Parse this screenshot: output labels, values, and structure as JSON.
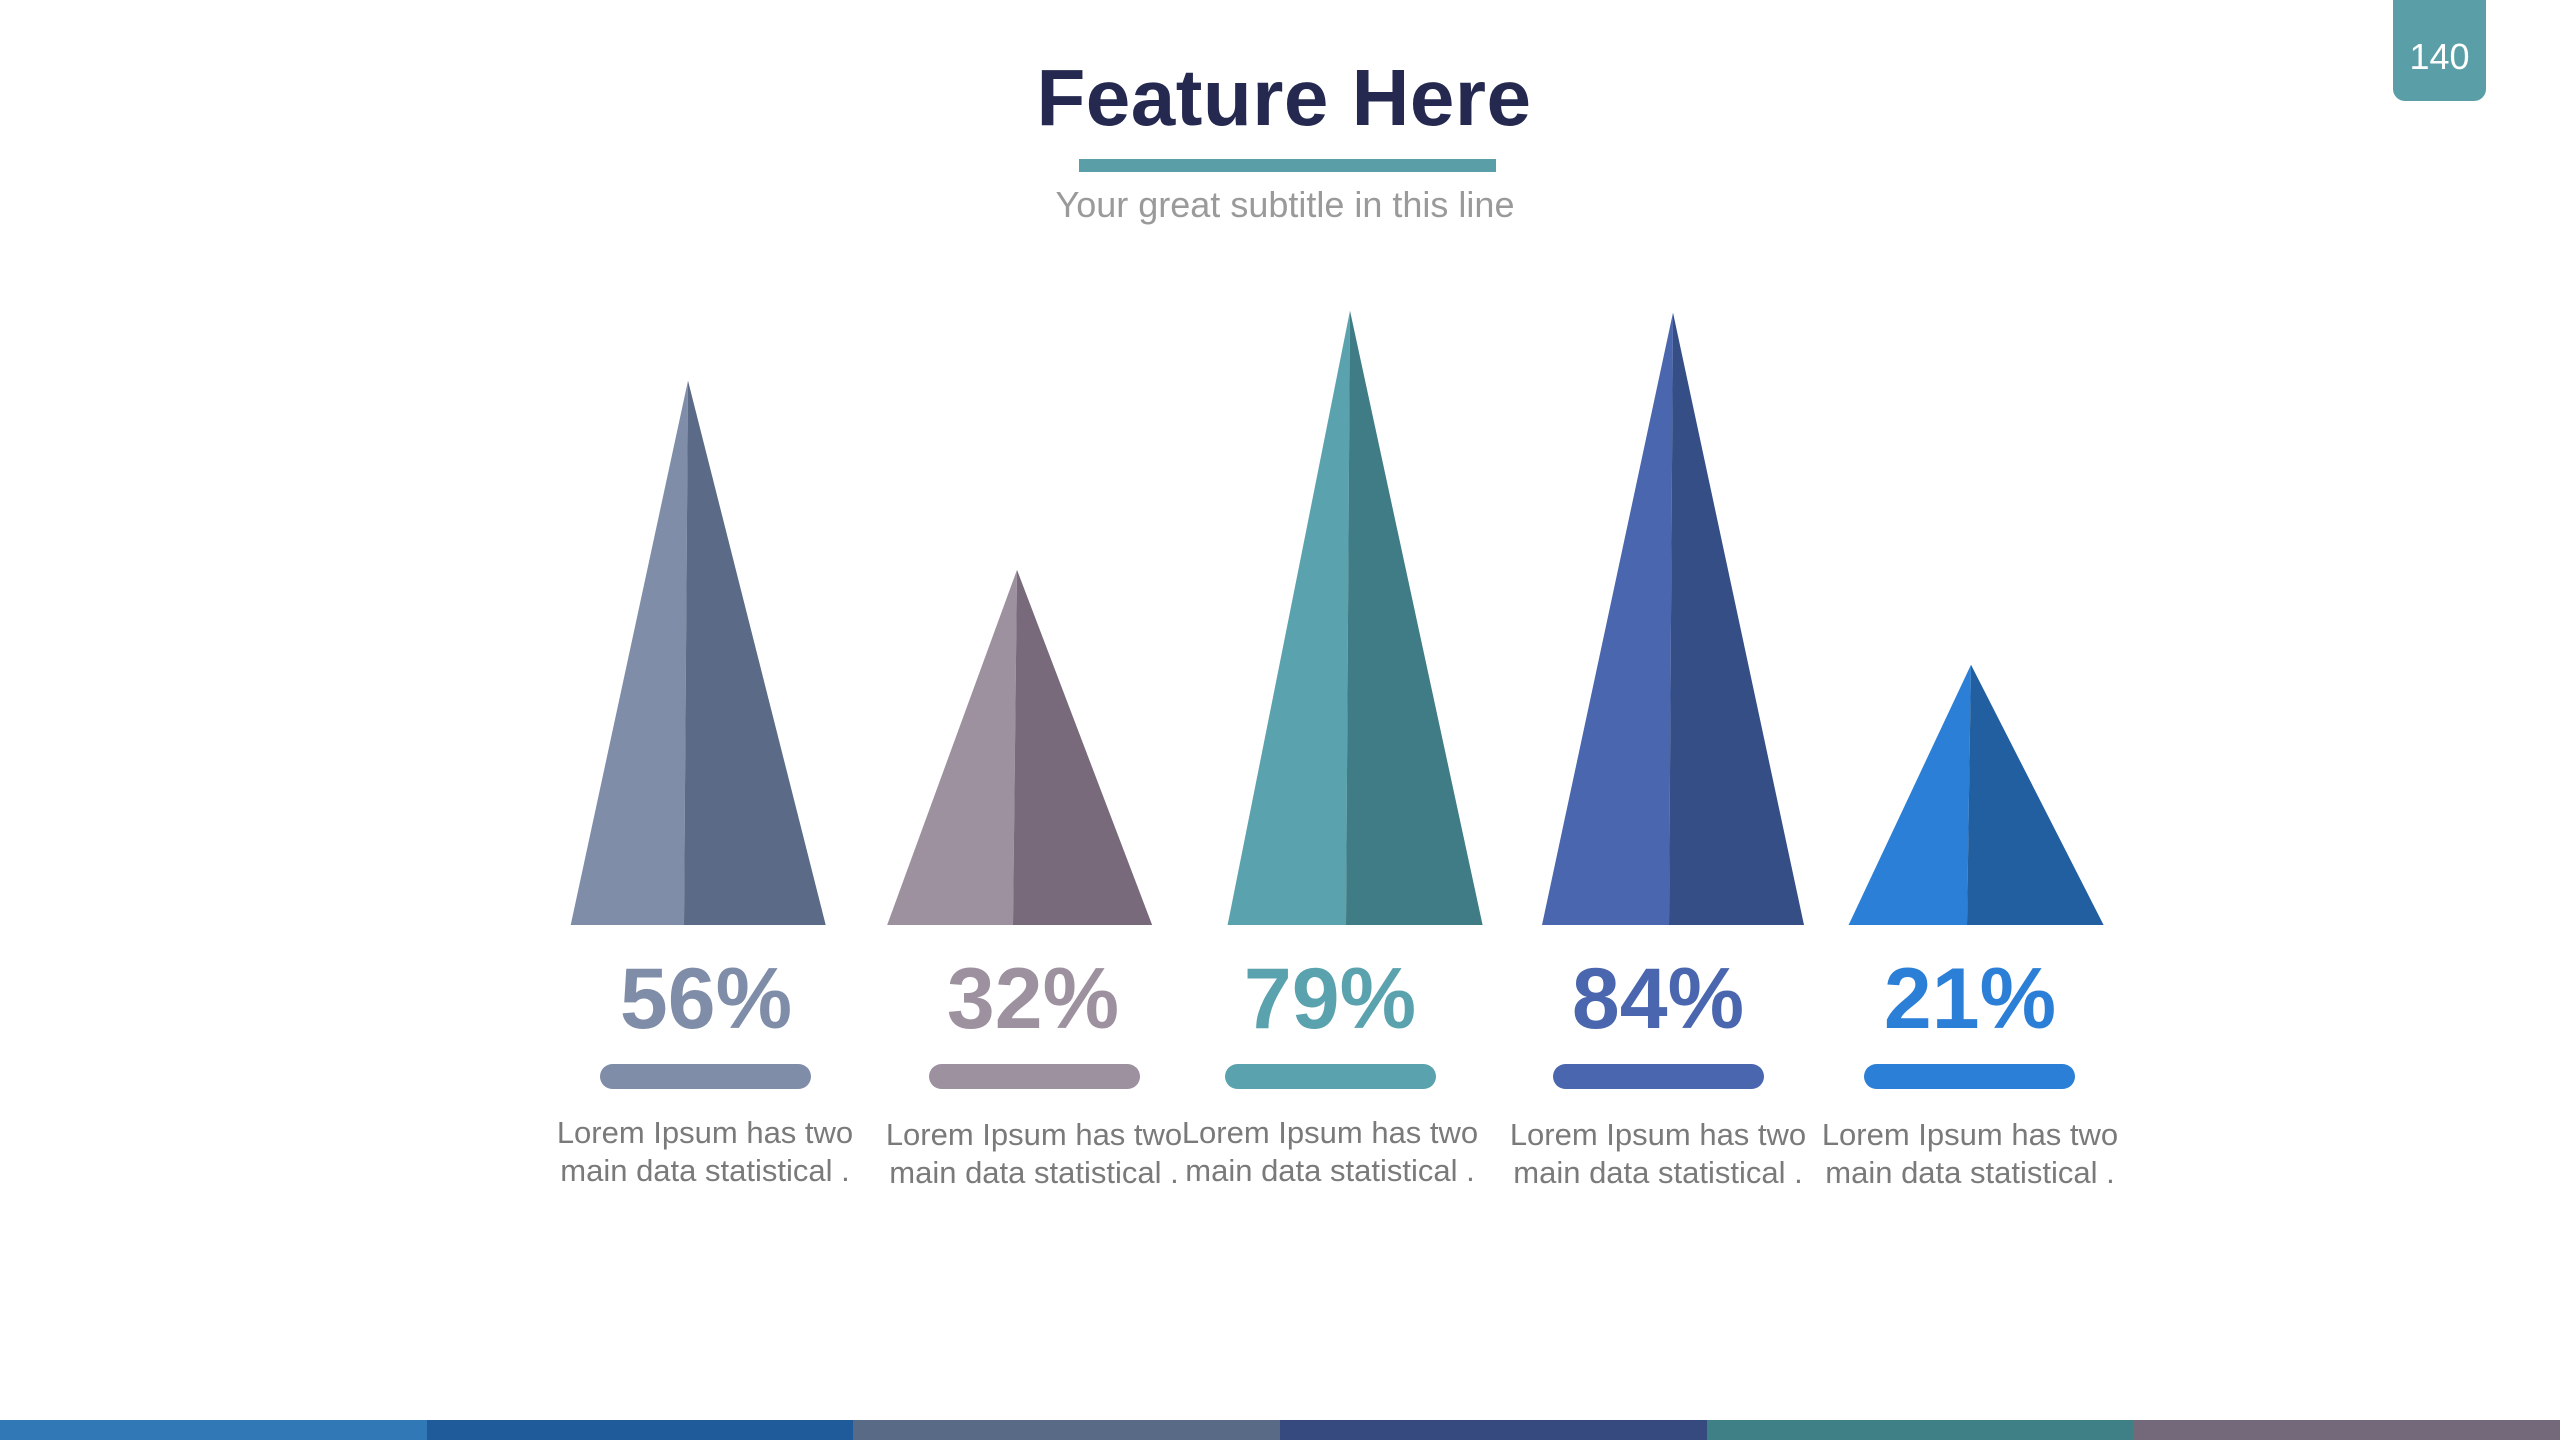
{
  "page_number": "140",
  "header": {
    "title": "Feature Here",
    "subtitle": "Your great subtitle in this line"
  },
  "colors": {
    "title": "#25294f",
    "accent": "#5a9fa7",
    "subtitle": "#9a9a9a",
    "description": "#7a7a7a",
    "bottom_bar": [
      "#3179b6",
      "#1f5a9b",
      "#586a86",
      "#364a80",
      "#3f7f86",
      "#74697a"
    ]
  },
  "chart_data": {
    "type": "bar",
    "mark_shape": "pyramid",
    "categories": [
      "56%",
      "32%",
      "79%",
      "84%",
      "21%"
    ],
    "values": [
      56,
      32,
      79,
      84,
      21
    ],
    "unit": "%",
    "title": "Feature Here",
    "subtitle": "Your great subtitle in this line",
    "xlabel": "",
    "ylabel": "",
    "value_labels": [
      "56%",
      "32%",
      "79%",
      "84%",
      "21%"
    ],
    "descriptions": [
      "Lorem Ipsum has two main data statistical .",
      "Lorem Ipsum has two main data statistical .",
      "Lorem Ipsum has two main data statistical .",
      "Lorem Ipsum has two main data statistical .",
      "Lorem Ipsum has two main data statistical ."
    ],
    "grid": false,
    "legend": "none",
    "colors": [
      {
        "light": "#7f8da8",
        "dark": "#5b6a86",
        "label": "#7f8da8"
      },
      {
        "light": "#9d909f",
        "dark": "#786a7b",
        "label": "#9d909f"
      },
      {
        "light": "#5aa2ad",
        "dark": "#407c85",
        "label": "#5aa2ad"
      },
      {
        "light": "#4a66ae",
        "dark": "#364e86",
        "label": "#4a66ae"
      },
      {
        "light": "#2b7fd6",
        "dark": "#215fa0",
        "label": "#2b7fd6"
      }
    ]
  }
}
